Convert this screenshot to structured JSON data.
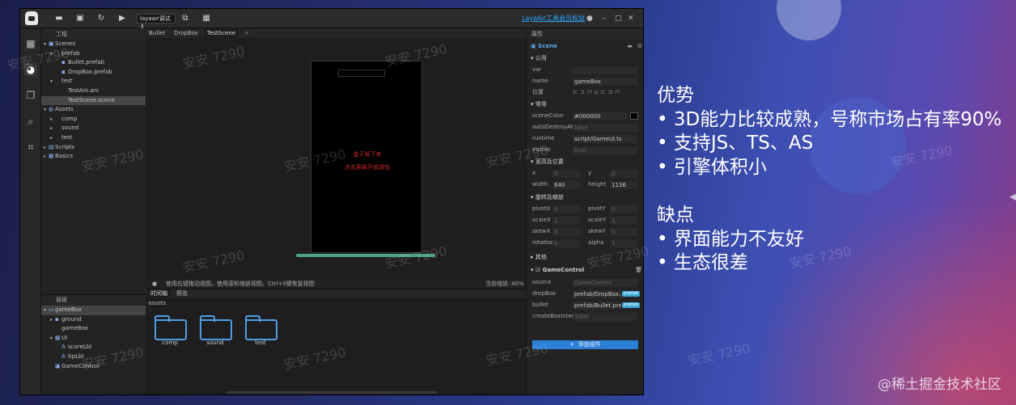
{
  "slide": {
    "advantages_title": "优势",
    "advantages": [
      "• 3D能力比较成熟，号称市场占有率90%",
      "• 支持JS、TS、AS",
      "• 引擎体积小"
    ],
    "disadvantages_title": "缺点",
    "disadvantages": [
      "• 界面能力不友好",
      "• 生态很差"
    ],
    "credit": "@稀土掘金技术社区",
    "watermark": "安安 7290"
  },
  "titlebar": {
    "run_target": "layaair调试",
    "vip_link": "LayaAir工具会员权益"
  },
  "project": {
    "header": "工程",
    "items": [
      {
        "label": "Scenes",
        "depth": 0,
        "arrow": "▾",
        "icon": "folder-icon",
        "glyph": "▣"
      },
      {
        "label": "prefab",
        "depth": 1,
        "arrow": "▾",
        "icon": "",
        "glyph": ""
      },
      {
        "label": "Bullet.prefab",
        "depth": 2,
        "arrow": "",
        "icon": "prefab-icon",
        "glyph": "▪"
      },
      {
        "label": "DropBox.prefab",
        "depth": 2,
        "arrow": "",
        "icon": "prefab-icon",
        "glyph": "▪"
      },
      {
        "label": "test",
        "depth": 1,
        "arrow": "▾",
        "icon": "",
        "glyph": ""
      },
      {
        "label": "TestAni.ani",
        "depth": 2,
        "arrow": "",
        "icon": "",
        "glyph": ""
      },
      {
        "label": "TestScene.scene",
        "depth": 2,
        "arrow": "",
        "icon": "",
        "glyph": ""
      },
      {
        "label": "Assets",
        "depth": 0,
        "arrow": "▾",
        "icon": "globe-icon",
        "glyph": "◍"
      },
      {
        "label": "comp",
        "depth": 1,
        "arrow": "▸",
        "icon": "",
        "glyph": ""
      },
      {
        "label": "sound",
        "depth": 1,
        "arrow": "▸",
        "icon": "",
        "glyph": ""
      },
      {
        "label": "test",
        "depth": 1,
        "arrow": "▸",
        "icon": "",
        "glyph": ""
      },
      {
        "label": "Scripts",
        "depth": 0,
        "arrow": "▸",
        "icon": "script-icon",
        "glyph": "▤"
      },
      {
        "label": "Basics",
        "depth": 0,
        "arrow": "▸",
        "icon": "basics-icon",
        "glyph": "▦"
      }
    ]
  },
  "hierarchy": {
    "header": "层级",
    "items": [
      {
        "label": "gameBox",
        "depth": 0,
        "arrow": "▾",
        "glyph": "▭"
      },
      {
        "label": "ground",
        "depth": 1,
        "arrow": "▸",
        "glyph": "▪"
      },
      {
        "label": "gameBox",
        "depth": 1,
        "arrow": "",
        "glyph": ""
      },
      {
        "label": "UI",
        "depth": 1,
        "arrow": "▾",
        "glyph": "▦"
      },
      {
        "label": "scoreLbl",
        "depth": 2,
        "arrow": "",
        "glyph": "A"
      },
      {
        "label": "tipLbl",
        "depth": 2,
        "arrow": "",
        "glyph": "A"
      },
      {
        "label": "GameControl",
        "depth": 1,
        "arrow": "",
        "glyph": "▣"
      }
    ]
  },
  "editor": {
    "tabs": [
      "Bullet",
      "DropBox",
      "TestScene"
    ],
    "canvas_text_1": "盒子掉下来",
    "canvas_text_2": "点击屏幕开始游戏",
    "status_text": "使用右键拖动视图，使用滚轮缩放视图，Ctrl+0键恢复视图",
    "zoom_label": "当前缩放:",
    "zoom_value": "40%"
  },
  "bottom": {
    "tabs": [
      "时间轴",
      "预览"
    ],
    "path": "assets",
    "folders": [
      "comp",
      "sound",
      "test"
    ]
  },
  "props": {
    "header": "属性",
    "node_type": "Scene",
    "sec_common": "公用",
    "var_label": "var",
    "name_label": "name",
    "name_value": "gameBox",
    "position_label": "位置",
    "sec_general": "常用",
    "scenecolor_label": "sceneColor",
    "scenecolor_value": "#000000",
    "autodestroy_label": "autoDestroyAtC",
    "autodestroy_value": "false",
    "runtime_label": "runtime",
    "runtime_value": "script/GameUI.ts",
    "visible_label": "visible",
    "visible_value": "true",
    "sec_size": "宽高及位置",
    "x_label": "x",
    "x_value": "0",
    "y_label": "y",
    "y_value": "0",
    "width_label": "width",
    "width_value": "640",
    "height_label": "height",
    "height_value": "1136",
    "sec_rotate": "旋转及缩放",
    "pivotx_label": "pivotX",
    "pivotx_value": "0",
    "pivoty_label": "pivotY",
    "pivoty_value": "0",
    "scalex_label": "scaleX",
    "scalex_value": "1",
    "scaley_label": "scaleY",
    "scaley_value": "1",
    "skewx_label": "skewX",
    "skewx_value": "0",
    "skewy_label": "skewY",
    "skewy_value": "0",
    "rotation_label": "rotation",
    "rotation_value": "0",
    "alpha_label": "alpha",
    "alpha_value": "1",
    "sec_other": "其他",
    "sec_component": "GameControl",
    "source_label": "source",
    "source_value": "GameControl",
    "dropbox_label": "dropBox",
    "dropbox_value": "prefab/DropBox.pr",
    "bullet_label": "bullet",
    "bullet_value": "prefab/Bullet.prefa",
    "createbox_label": "createBoxInterv",
    "createbox_value": "1000",
    "chip_label": "prefab",
    "add_component": "添加组件"
  },
  "colors": {
    "accent": "#2b7fd6",
    "canvas_text": "#c8282a",
    "scroll_accent": "#4fa08b"
  }
}
